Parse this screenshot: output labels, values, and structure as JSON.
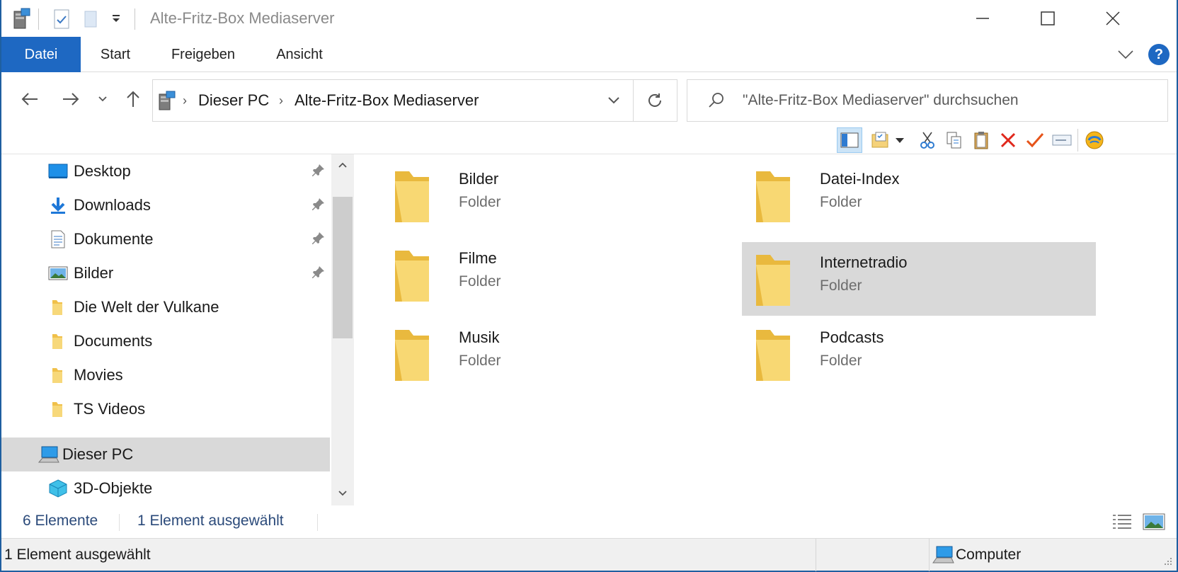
{
  "window": {
    "title": "Alte-Fritz-Box Mediaserver",
    "icons": [
      "mediaserver-icon",
      "properties-icon",
      "new-folder-icon",
      "qa-dropdown-icon",
      "minimize-icon",
      "maximize-icon",
      "close-icon"
    ]
  },
  "ribbon": {
    "tabs": [
      {
        "label": "Datei"
      },
      {
        "label": "Start"
      },
      {
        "label": "Freigeben"
      },
      {
        "label": "Ansicht"
      }
    ],
    "help_label": "?"
  },
  "address": {
    "crumbs": [
      "Dieser PC",
      "Alte-Fritz-Box Mediaserver"
    ]
  },
  "search": {
    "placeholder": "\"Alte-Fritz-Box Mediaserver\" durchsuchen"
  },
  "toolbar": {
    "icons": [
      "preview-pane-icon",
      "properties-icon",
      "dropdown-icon",
      "cut-icon",
      "copy-icon",
      "paste-icon",
      "delete-icon",
      "check-icon",
      "rename-icon",
      "shell-icon"
    ]
  },
  "nav": {
    "items": [
      {
        "label": "Desktop",
        "icon": "desktop-icon",
        "pinned": true
      },
      {
        "label": "Downloads",
        "icon": "download-icon",
        "pinned": true
      },
      {
        "label": "Dokumente",
        "icon": "documents-icon",
        "pinned": true
      },
      {
        "label": "Bilder",
        "icon": "pictures-icon",
        "pinned": true
      },
      {
        "label": "Die Welt der Vulkane",
        "icon": "folder-icon",
        "pinned": false
      },
      {
        "label": "Documents",
        "icon": "folder-icon",
        "pinned": false
      },
      {
        "label": "Movies",
        "icon": "folder-icon",
        "pinned": false
      },
      {
        "label": "TS Videos",
        "icon": "folder-icon",
        "pinned": false
      },
      {
        "label": "Dieser PC",
        "icon": "computer-icon",
        "pinned": false,
        "selected": true
      },
      {
        "label": "3D-Objekte",
        "icon": "3d-objects-icon",
        "pinned": false
      }
    ]
  },
  "content": {
    "folders": [
      {
        "name": "Bilder",
        "type": "Folder"
      },
      {
        "name": "Datei-Index",
        "type": "Folder"
      },
      {
        "name": "Filme",
        "type": "Folder"
      },
      {
        "name": "Internetradio",
        "type": "Folder",
        "selected": true
      },
      {
        "name": "Musik",
        "type": "Folder"
      },
      {
        "name": "Podcasts",
        "type": "Folder"
      }
    ]
  },
  "info": {
    "count": "6 Elemente",
    "selection": "1 Element ausgewählt"
  },
  "status": {
    "left": "1 Element ausgewählt",
    "zone": "Computer"
  },
  "colors": {
    "accent": "#1e68c2",
    "folder": "#f5cf63",
    "selected_bg": "#d9d9d9"
  }
}
